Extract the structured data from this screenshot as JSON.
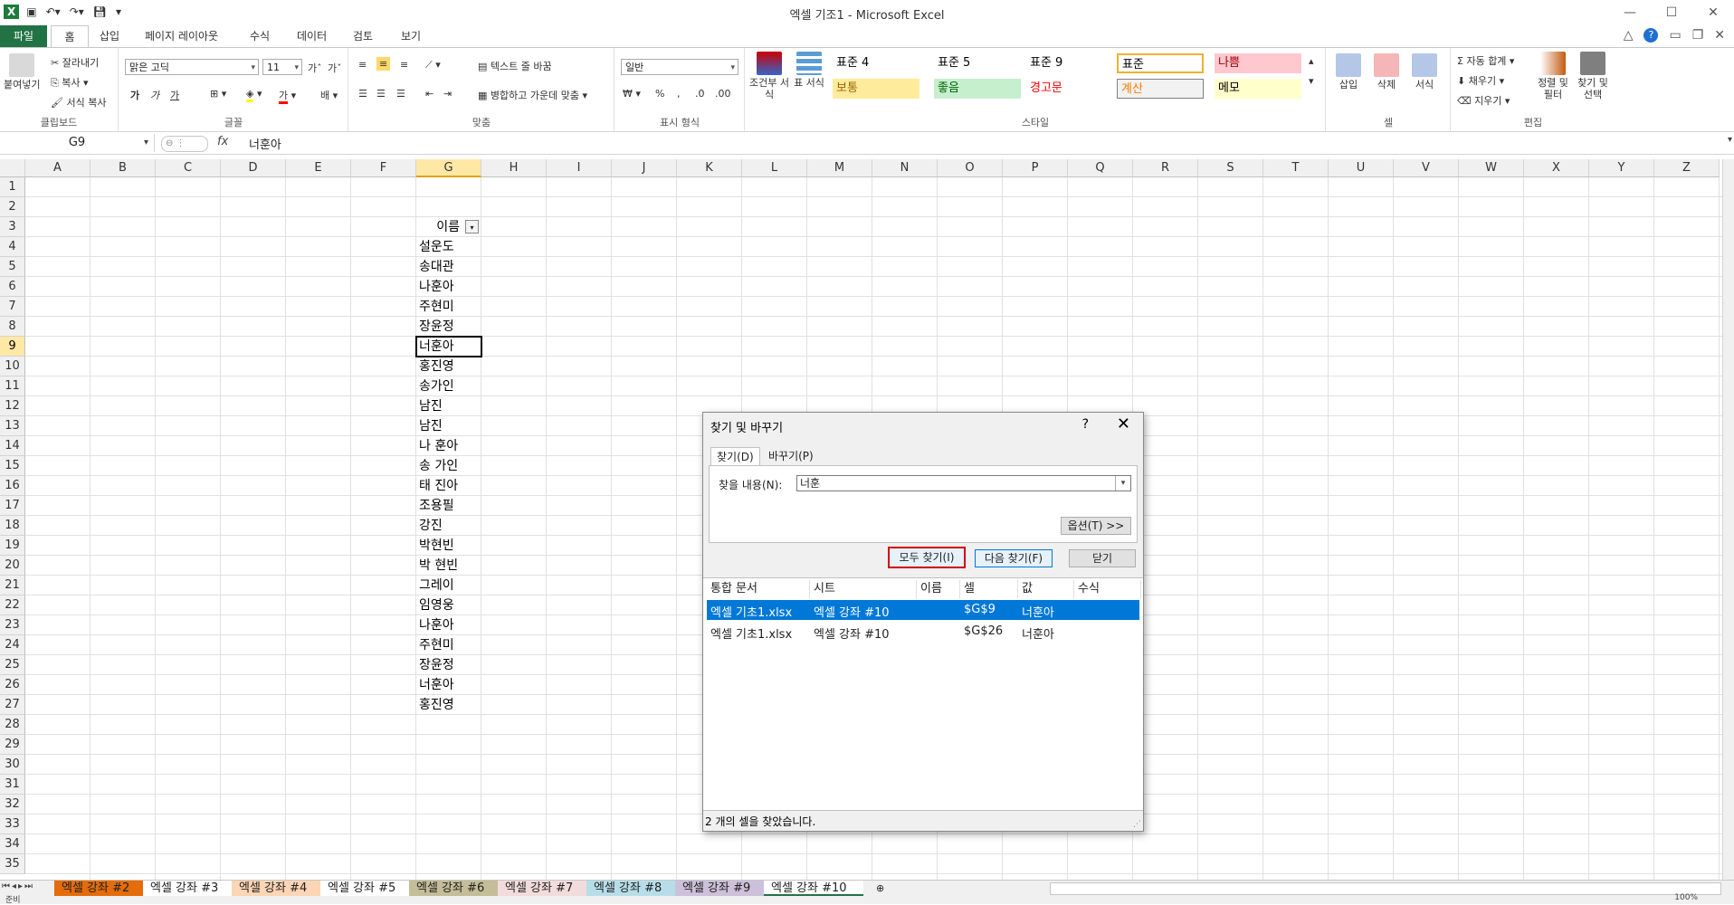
{
  "window": {
    "title": "엑셀 기조1 - Microsoft Excel",
    "minimize": "—",
    "maximize": "☐",
    "close": "✕"
  },
  "ribbon_tabs": [
    "파일",
    "홈",
    "삽입",
    "페이지 레이아웃",
    "수식",
    "데이터",
    "검토",
    "보기"
  ],
  "ribbon": {
    "clipboard": {
      "paste": "붙여넣기",
      "cut": "잘라내기",
      "copy": "복사",
      "format_painter": "서식 복사",
      "label": "클립보드"
    },
    "font": {
      "name": "맑은 고딕",
      "size": "11",
      "label": "글꼴",
      "bold": "가",
      "italic": "가",
      "underline": "가",
      "font_color": "가"
    },
    "alignment": {
      "wrap": "텍스트 줄 바꿈",
      "merge": "병합하고 가운데 맞춤",
      "label": "맞춤"
    },
    "number": {
      "format": "일반",
      "label": "표시 형식",
      "percent": "%",
      "comma": ","
    },
    "styles": {
      "conditional": "조건부 서식",
      "table": "표 서식",
      "cells": [
        {
          "text": "표준 4",
          "bg": "#ffffff",
          "fg": "#000000"
        },
        {
          "text": "표준 5",
          "bg": "#ffffff",
          "fg": "#000000"
        },
        {
          "text": "표준 9",
          "bg": "#ffffff",
          "fg": "#000000"
        },
        {
          "text": "표준",
          "bg": "#ffffff",
          "fg": "#000000"
        },
        {
          "text": "나쁨",
          "bg": "#ffc7ce",
          "fg": "#9c0006"
        },
        {
          "text": "보통",
          "bg": "#ffeb9c",
          "fg": "#9c6500"
        },
        {
          "text": "좋음",
          "bg": "#c6efce",
          "fg": "#006100"
        },
        {
          "text": "경고문",
          "bg": "#ffffff",
          "fg": "#ff0000"
        },
        {
          "text": "계산",
          "bg": "#f2f2f2",
          "fg": "#fa7d00"
        },
        {
          "text": "메모",
          "bg": "#ffffcc",
          "fg": "#000000"
        }
      ],
      "label": "스타일"
    },
    "cells": {
      "insert": "삽입",
      "delete": "삭제",
      "format": "서식",
      "label": "셀"
    },
    "editing": {
      "autosum": "자동 합계",
      "fill": "채우기",
      "clear": "지우기",
      "sort": "정렬 및 필터",
      "find": "찾기 및 선택",
      "label": "편집"
    }
  },
  "formula_bar": {
    "name_box": "G9",
    "fx": "fx",
    "content": "너훈아"
  },
  "columns": [
    "A",
    "B",
    "C",
    "D",
    "E",
    "F",
    "G",
    "H",
    "I",
    "J",
    "K",
    "L",
    "M",
    "N",
    "O",
    "P",
    "Q",
    "R",
    "S",
    "T",
    "U",
    "V",
    "W",
    "X",
    "Y",
    "Z"
  ],
  "selected_column": "G",
  "rows": [
    "1",
    "2",
    "3",
    "4",
    "5",
    "6",
    "7",
    "8",
    "9",
    "10",
    "11",
    "12",
    "13",
    "14",
    "15",
    "16",
    "17",
    "18",
    "19",
    "20",
    "21",
    "22",
    "23",
    "24",
    "25",
    "26",
    "27",
    "28",
    "29",
    "30",
    "31",
    "32",
    "33",
    "34",
    "35"
  ],
  "selected_row": "9",
  "column_g": {
    "header": "이름",
    "values": [
      "설운도",
      "송대관",
      "나훈아",
      "주현미",
      "장윤정",
      "너훈아",
      "홍진영",
      "송가인",
      "남진",
      "남진",
      "나 훈아",
      "송 가인",
      "태 진아",
      "조용필",
      "강진",
      "박현빈",
      "박 현빈",
      "그레이",
      "임영웅",
      "나훈아",
      "주현미",
      "장윤정",
      "너훈아",
      "홍진영"
    ]
  },
  "sheet_tabs": [
    "엑셀 강좌 #2",
    "엑셀 강좌 #3",
    "엑셀 강좌 #4",
    "엑셀 강좌 #5",
    "엑셀 강좌 #6",
    "엑셀 강좌 #7",
    "엑셀 강좌 #8",
    "엑셀 강좌 #9",
    "엑셀 강좌 #10"
  ],
  "sheet_tab_colors": [
    "#e46c0a",
    "#ffffff",
    "#fcd5b4",
    "#ffffff",
    "#c4bd97",
    "#f2dcdb",
    "#b7dee8",
    "#ccc0da",
    "#ffffff"
  ],
  "active_sheet": "엑셀 강좌 #10",
  "dialog": {
    "title": "찾기 및 바꾸기",
    "help": "?",
    "close": "✕",
    "tab_find": "찾기(D)",
    "tab_replace": "바꾸기(P)",
    "find_label": "찾을 내용(N):",
    "find_value": "너훈",
    "options_button": "옵션(T) >>",
    "find_all_button": "모두 찾기(I)",
    "find_next_button": "다음 찾기(F)",
    "close_button": "닫기",
    "result_columns": [
      "통합 문서",
      "시트",
      "이름",
      "셀",
      "값",
      "수식"
    ],
    "results": [
      {
        "book": "엑셀 기초1.xlsx",
        "sheet": "엑셀 강좌 #10",
        "name": "",
        "cell": "$G$9",
        "value": "너훈아",
        "formula": ""
      },
      {
        "book": "엑셀 기초1.xlsx",
        "sheet": "엑셀 강좌 #10",
        "name": "",
        "cell": "$G$26",
        "value": "너훈아",
        "formula": ""
      }
    ],
    "status": "2 개의 셀을 찾았습니다."
  },
  "status_bar": {
    "left": "준비",
    "zoom": "100%"
  }
}
